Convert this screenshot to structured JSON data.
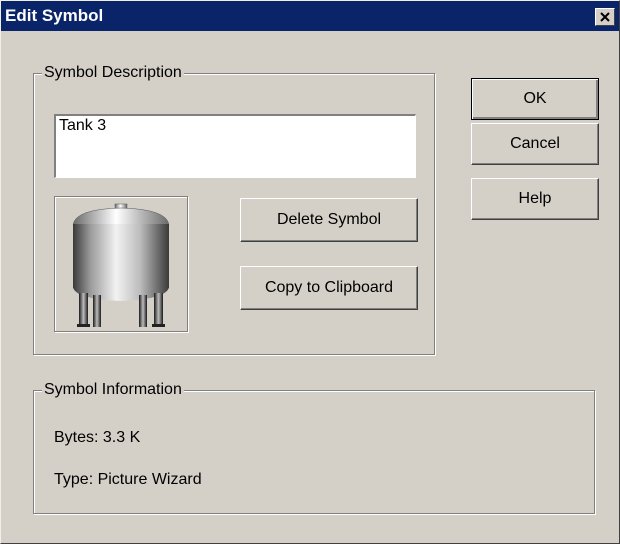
{
  "window": {
    "title": "Edit Symbol",
    "close_glyph": "×"
  },
  "symbol_description": {
    "group_label": "Symbol Description",
    "text_value": "Tank 3",
    "preview_icon": "tank-icon"
  },
  "buttons": {
    "delete_symbol": "Delete Symbol",
    "copy_to_clipboard": "Copy to Clipboard",
    "ok": "OK",
    "cancel": "Cancel",
    "help": "Help"
  },
  "symbol_information": {
    "group_label": "Symbol Information",
    "bytes": "Bytes: 3.3 K",
    "type": "Type: Picture Wizard"
  },
  "colors": {
    "titlebar": "#0a246a",
    "dialog_face": "#d4d0c8"
  }
}
